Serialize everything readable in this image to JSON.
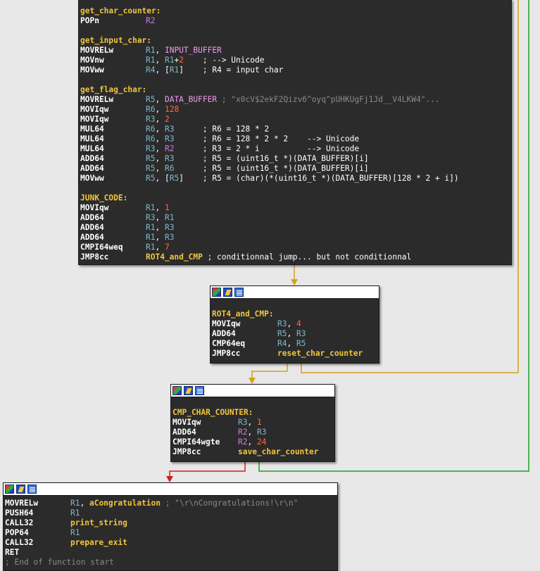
{
  "colors": {
    "background": "#e8e8e8",
    "node_bg": "#2b2b2b",
    "label": "#f2c53d",
    "edge_unconditional": "#d4a018",
    "edge_true": "#1aa41a",
    "edge_false": "#cc2020"
  },
  "header_icons": [
    "graph-overview-icon",
    "edit-node-icon",
    "text-view-icon"
  ],
  "node1": {
    "lines": [
      {
        "t": "lbl",
        "text": "get_char_counter:"
      },
      {
        "mn": "POPn",
        "ops": [
          {
            "c": "reg2",
            "t": "R2"
          }
        ]
      },
      {
        "t": "blank"
      },
      {
        "t": "lbl",
        "text": "get_input_char:"
      },
      {
        "mn": "MOVRELw",
        "ops": [
          {
            "c": "reg1",
            "t": "R1"
          },
          {
            "c": "white",
            "t": ", "
          },
          {
            "c": "sym",
            "t": "INPUT_BUFFER"
          }
        ]
      },
      {
        "mn": "MOVnw",
        "ops": [
          {
            "c": "reg1",
            "t": "R1"
          },
          {
            "c": "white",
            "t": ", "
          },
          {
            "c": "reg1",
            "t": "R1"
          },
          {
            "c": "white",
            "t": "+"
          },
          {
            "c": "num",
            "t": "2"
          },
          {
            "c": "cmt",
            "t": "    ; --> Unicode"
          }
        ]
      },
      {
        "mn": "MOVww",
        "ops": [
          {
            "c": "reg1",
            "t": "R4"
          },
          {
            "c": "white",
            "t": ", ["
          },
          {
            "c": "reg1",
            "t": "R1"
          },
          {
            "c": "white",
            "t": "]"
          },
          {
            "c": "cmt",
            "t": "    ; R4 = input char"
          }
        ]
      },
      {
        "t": "blank"
      },
      {
        "t": "lbl",
        "text": "get_flag_char:"
      },
      {
        "mn": "MOVRELw",
        "ops": [
          {
            "c": "reg1",
            "t": "R5"
          },
          {
            "c": "white",
            "t": ", "
          },
          {
            "c": "sym",
            "t": "DATA_BUFFER"
          },
          {
            "c": "cmtg",
            "t": " ; \"x0cV$2ekF2Qizv6^oyq^pUHKUgFj1Jd__V4LKW4\"..."
          }
        ]
      },
      {
        "mn": "MOVIqw",
        "ops": [
          {
            "c": "reg1",
            "t": "R6"
          },
          {
            "c": "white",
            "t": ", "
          },
          {
            "c": "num",
            "t": "128"
          }
        ]
      },
      {
        "mn": "MOVIqw",
        "ops": [
          {
            "c": "reg1",
            "t": "R3"
          },
          {
            "c": "white",
            "t": ", "
          },
          {
            "c": "num",
            "t": "2"
          }
        ]
      },
      {
        "mn": "MUL64",
        "ops": [
          {
            "c": "reg1",
            "t": "R6"
          },
          {
            "c": "white",
            "t": ", "
          },
          {
            "c": "reg1",
            "t": "R3"
          },
          {
            "c": "cmt",
            "t": "      ; R6 = 128 * 2"
          }
        ]
      },
      {
        "mn": "MUL64",
        "ops": [
          {
            "c": "reg1",
            "t": "R6"
          },
          {
            "c": "white",
            "t": ", "
          },
          {
            "c": "reg1",
            "t": "R3"
          },
          {
            "c": "cmt",
            "t": "      ; R6 = 128 * 2 * 2    --> Unicode"
          }
        ]
      },
      {
        "mn": "MUL64",
        "ops": [
          {
            "c": "reg1",
            "t": "R3"
          },
          {
            "c": "white",
            "t": ", "
          },
          {
            "c": "reg2",
            "t": "R2"
          },
          {
            "c": "cmt",
            "t": "      ; R3 = 2 * i          --> Unicode"
          }
        ]
      },
      {
        "mn": "ADD64",
        "ops": [
          {
            "c": "reg1",
            "t": "R5"
          },
          {
            "c": "white",
            "t": ", "
          },
          {
            "c": "reg1",
            "t": "R3"
          },
          {
            "c": "cmt",
            "t": "      ; R5 = (uint16_t *)(DATA_BUFFER)[i]"
          }
        ]
      },
      {
        "mn": "ADD64",
        "ops": [
          {
            "c": "reg1",
            "t": "R5"
          },
          {
            "c": "white",
            "t": ", "
          },
          {
            "c": "reg1",
            "t": "R6"
          },
          {
            "c": "cmt",
            "t": "      ; R5 = (uint16_t *)(DATA_BUFFER)[i]"
          }
        ]
      },
      {
        "mn": "MOVww",
        "ops": [
          {
            "c": "reg1",
            "t": "R5"
          },
          {
            "c": "white",
            "t": ", ["
          },
          {
            "c": "reg1",
            "t": "R5"
          },
          {
            "c": "white",
            "t": "]"
          },
          {
            "c": "cmt",
            "t": "    ; R5 = (char)(*(uint16_t *)(DATA_BUFFER)[128 * 2 + i])"
          }
        ]
      },
      {
        "t": "blank"
      },
      {
        "t": "lbl",
        "text": "JUNK_CODE:"
      },
      {
        "mn": "MOVIqw",
        "ops": [
          {
            "c": "reg1",
            "t": "R1"
          },
          {
            "c": "white",
            "t": ", "
          },
          {
            "c": "num",
            "t": "1"
          }
        ]
      },
      {
        "mn": "ADD64",
        "ops": [
          {
            "c": "reg1",
            "t": "R3"
          },
          {
            "c": "white",
            "t": ", "
          },
          {
            "c": "reg1",
            "t": "R1"
          }
        ]
      },
      {
        "mn": "ADD64",
        "ops": [
          {
            "c": "reg1",
            "t": "R1"
          },
          {
            "c": "white",
            "t": ", "
          },
          {
            "c": "reg1",
            "t": "R3"
          }
        ]
      },
      {
        "mn": "ADD64",
        "ops": [
          {
            "c": "reg1",
            "t": "R1"
          },
          {
            "c": "white",
            "t": ", "
          },
          {
            "c": "reg1",
            "t": "R3"
          }
        ]
      },
      {
        "mn": "CMPI64weq",
        "ops": [
          {
            "c": "reg1",
            "t": "R1"
          },
          {
            "c": "white",
            "t": ", "
          },
          {
            "c": "num",
            "t": "7"
          }
        ]
      },
      {
        "mn": "JMP8cc",
        "ops": [
          {
            "c": "jtarget",
            "t": "ROT4_and_CMP"
          },
          {
            "c": "cmt",
            "t": " ; conditionnal jump... but not conditionnal"
          }
        ]
      }
    ]
  },
  "node2": {
    "lines": [
      {
        "t": "blank"
      },
      {
        "t": "lbl",
        "text": "ROT4_and_CMP:"
      },
      {
        "mn": "MOVIqw",
        "ops": [
          {
            "c": "reg1",
            "t": "R3"
          },
          {
            "c": "white",
            "t": ", "
          },
          {
            "c": "num",
            "t": "4"
          }
        ]
      },
      {
        "mn": "ADD64",
        "ops": [
          {
            "c": "reg1",
            "t": "R5"
          },
          {
            "c": "white",
            "t": ", "
          },
          {
            "c": "reg1",
            "t": "R3"
          }
        ]
      },
      {
        "mn": "CMP64eq",
        "ops": [
          {
            "c": "reg1",
            "t": "R4"
          },
          {
            "c": "white",
            "t": ", "
          },
          {
            "c": "reg1",
            "t": "R5"
          }
        ]
      },
      {
        "mn": "JMP8cc",
        "ops": [
          {
            "c": "jtarget",
            "t": "reset_char_counter"
          }
        ]
      }
    ]
  },
  "node3": {
    "lines": [
      {
        "t": "blank"
      },
      {
        "t": "lbl",
        "text": "CMP_CHAR_COUNTER:"
      },
      {
        "mn": "MOVIqw",
        "ops": [
          {
            "c": "reg1",
            "t": "R3"
          },
          {
            "c": "white",
            "t": ", "
          },
          {
            "c": "num",
            "t": "1"
          }
        ]
      },
      {
        "mn": "ADD64",
        "ops": [
          {
            "c": "reg2",
            "t": "R2"
          },
          {
            "c": "white",
            "t": ", "
          },
          {
            "c": "reg1",
            "t": "R3"
          }
        ]
      },
      {
        "mn": "CMPI64wgte",
        "ops": [
          {
            "c": "reg2",
            "t": "R2"
          },
          {
            "c": "white",
            "t": ", "
          },
          {
            "c": "num",
            "t": "24"
          }
        ]
      },
      {
        "mn": "JMP8cc",
        "ops": [
          {
            "c": "jtarget",
            "t": "save_char_counter"
          }
        ]
      }
    ]
  },
  "node4": {
    "lines": [
      {
        "mn": "MOVRELw",
        "ops": [
          {
            "c": "reg1",
            "t": "R1"
          },
          {
            "c": "white",
            "t": ", "
          },
          {
            "c": "call",
            "t": "aCongratulation"
          },
          {
            "c": "cmtg",
            "t": " ; \"\\r\\nCongratulations!\\r\\n\""
          }
        ]
      },
      {
        "mn": "PUSH64",
        "ops": [
          {
            "c": "reg1",
            "t": "R1"
          }
        ]
      },
      {
        "mn": "CALL32",
        "ops": [
          {
            "c": "call",
            "t": "print_string"
          }
        ]
      },
      {
        "mn": "POP64",
        "ops": [
          {
            "c": "reg1",
            "t": "R1"
          }
        ]
      },
      {
        "mn": "CALL32",
        "ops": [
          {
            "c": "call",
            "t": "prepare_exit"
          }
        ]
      },
      {
        "mn": "RET",
        "ops": []
      },
      {
        "t": "cmtg",
        "text": "; End of function start"
      }
    ]
  }
}
